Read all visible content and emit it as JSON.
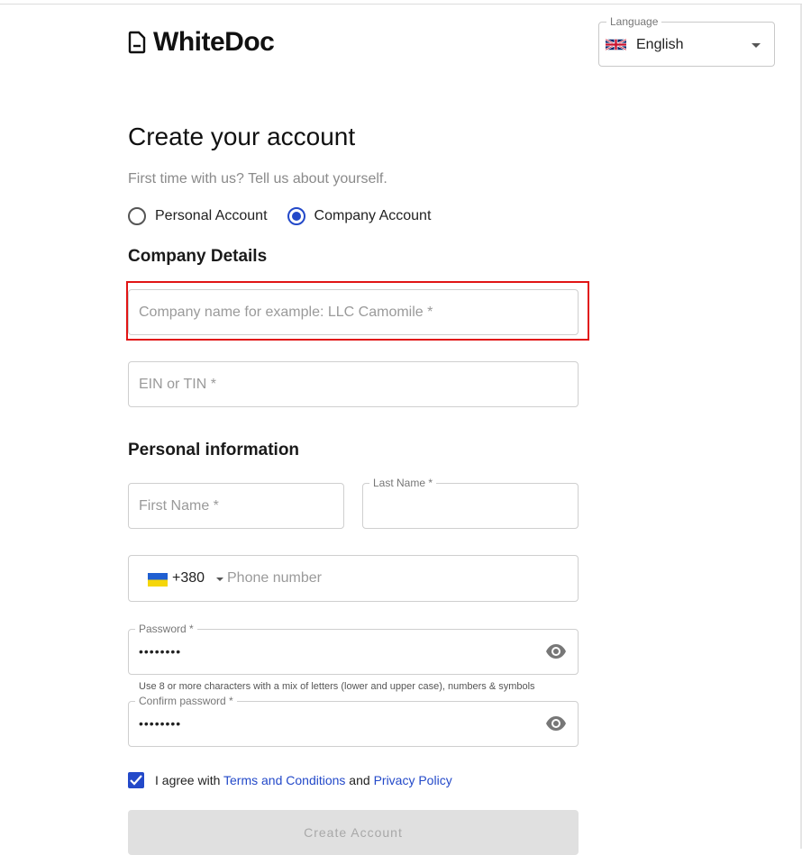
{
  "app": {
    "name": "WhiteDoc"
  },
  "language": {
    "legend": "Language",
    "selected": "English",
    "flag_icon": "uk-flag-icon"
  },
  "page": {
    "title": "Create your account",
    "subtitle": "First time with us? Tell us about yourself."
  },
  "account_type": {
    "options": [
      {
        "label": "Personal Account",
        "checked": false
      },
      {
        "label": "Company Account",
        "checked": true
      }
    ]
  },
  "company_details": {
    "heading": "Company Details",
    "company_name_placeholder": "Company name for example: LLC Camomile *",
    "ein_placeholder": "EIN or TIN *"
  },
  "personal_info": {
    "heading": "Personal information",
    "first_name_placeholder": "First Name *",
    "last_name_legend": "Last Name *",
    "phone": {
      "country_code": "+380",
      "flag_icon": "ukraine-flag-icon",
      "placeholder": "Phone number"
    },
    "password_legend": "Password *",
    "password_value": "••••••••",
    "password_hint": "Use 8 or more characters with a mix of letters (lower and upper case), numbers & symbols",
    "confirm_password_legend": "Confirm password *",
    "confirm_password_value": "••••••••"
  },
  "agreement": {
    "checked": true,
    "prefix": "I agree with ",
    "terms_link": "Terms and Conditions",
    "and": " and ",
    "privacy_link": "Privacy Policy"
  },
  "actions": {
    "create_label": "Create Account"
  },
  "colors": {
    "accent": "#2349c9",
    "highlight": "#e11414",
    "disabled_bg": "#e0e0e0"
  }
}
